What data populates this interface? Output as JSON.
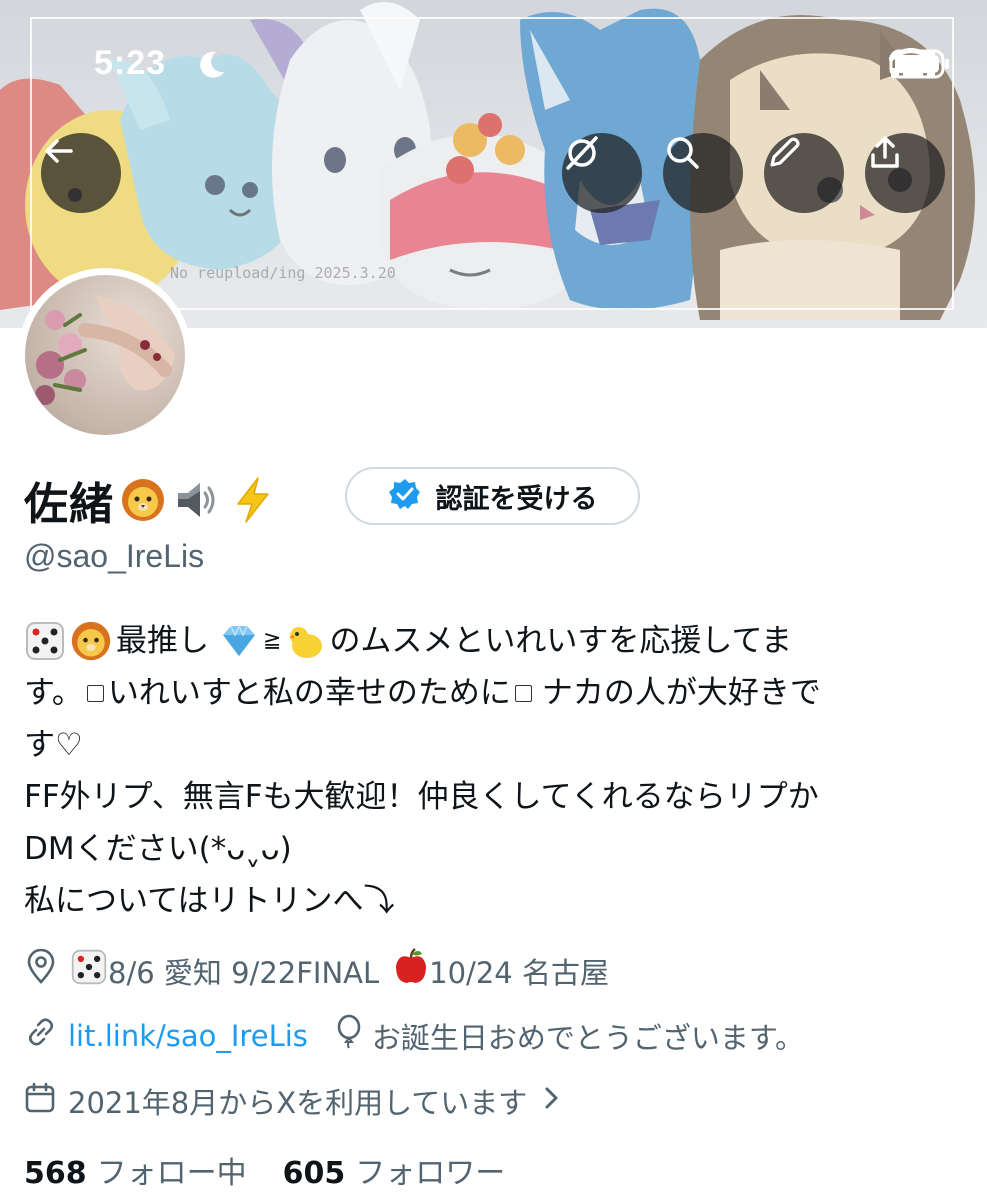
{
  "status_bar": {
    "time": "5:23"
  },
  "banner": {
    "watermark": "No reupload/ing  2025.3.20"
  },
  "header_buttons": {
    "back": "back-arrow-icon",
    "circle": "circle-slash-icon",
    "search": "search-icon",
    "edit": "pencil-icon",
    "share": "share-icon"
  },
  "profile": {
    "display_name": "佐緒",
    "name_emojis": [
      "lion-emoji",
      "speaker-emoji",
      "lightning-emoji"
    ],
    "verify_label": "認証を受ける",
    "handle": "@sao_IreLis",
    "bio": {
      "line1_text": "最推し",
      "line1_sep": "≧",
      "line1_tail": "のムスメといれいすを応援してま",
      "line2_a": "す。",
      "line2_b": "いれいすと私の幸せのために",
      "line2_c": "ナカの人が大好きで",
      "line3": "す♡",
      "line4": "FF外リプ、無言Fも大歓迎！仲良くしてくれるならリプか",
      "line5": "DMください(*ᴗˬᴗ)",
      "line6": "私についてはリトリンへ⤵"
    },
    "location": "8/6 愛知 9/22FINAL",
    "location_tail": "10/24 名古屋",
    "website": "lit.link/sao_IreLis",
    "birthday": "お誕生日おめでとうございます。",
    "joined": "2021年8月からXを利用しています",
    "following_count": "568",
    "following_label": "フォロー中",
    "followers_count": "605",
    "followers_label": "フォロワー"
  },
  "colors": {
    "accent": "#1d9bf0",
    "secondary_text": "#536471",
    "border": "#cfd9de"
  }
}
